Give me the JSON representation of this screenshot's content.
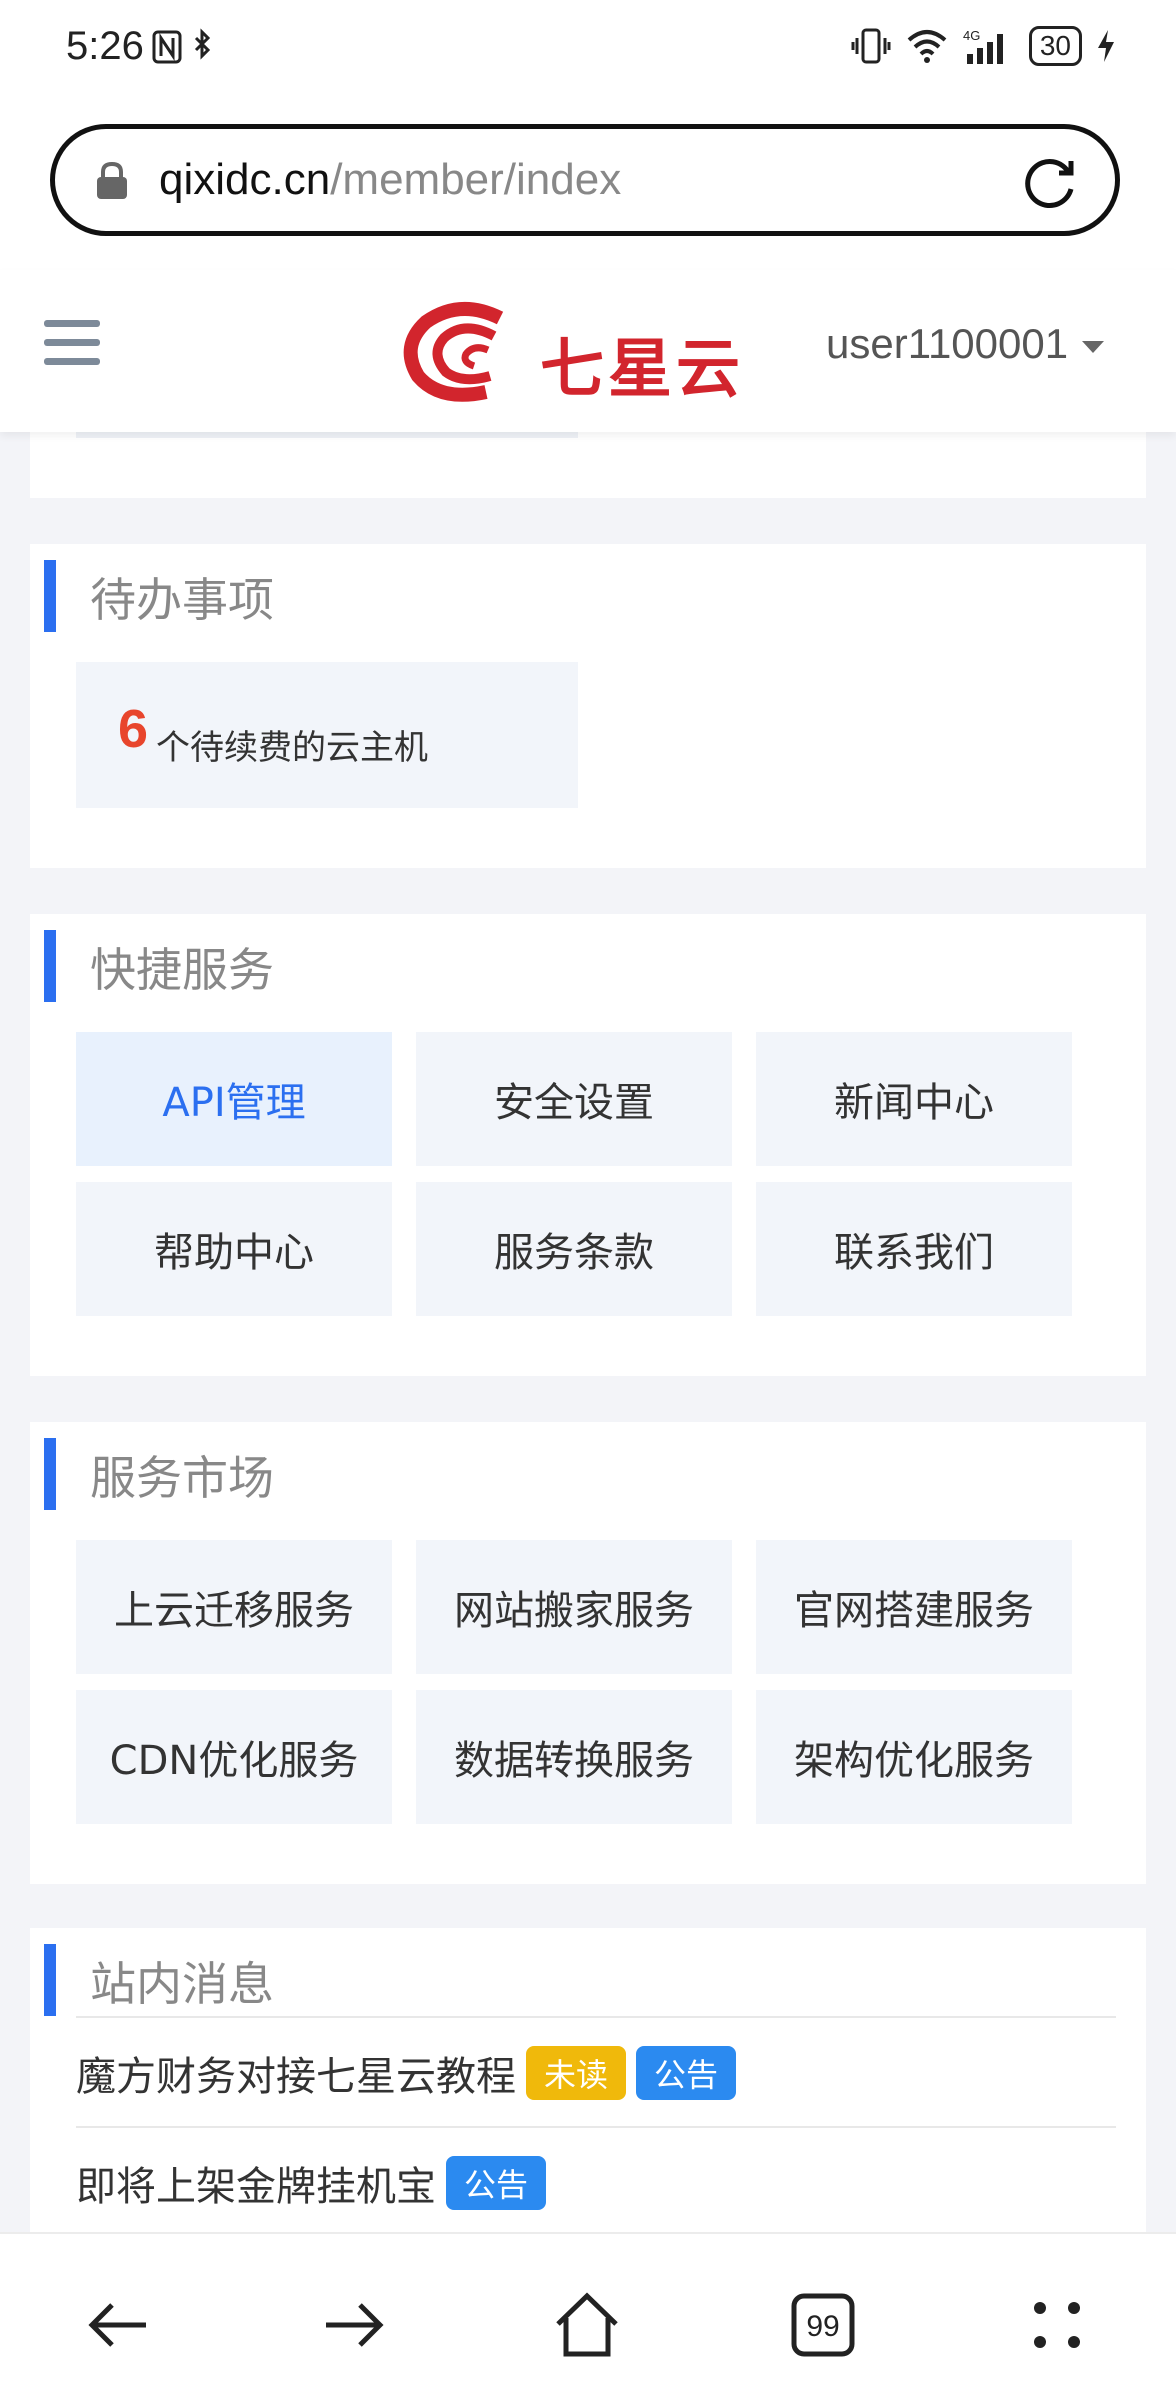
{
  "status_bar": {
    "time": "5:26",
    "battery": "30",
    "network": "4G"
  },
  "browser": {
    "url_domain": "qixidc.cn",
    "url_path": "/member/index"
  },
  "header": {
    "logo_text": "七星云",
    "username": "user1100001"
  },
  "todo": {
    "title": "待办事项",
    "items": [
      {
        "count": "6",
        "label": "个待续费的云主机"
      }
    ]
  },
  "quick_services": {
    "title": "快捷服务",
    "items": [
      {
        "label": "API管理"
      },
      {
        "label": "安全设置"
      },
      {
        "label": "新闻中心"
      },
      {
        "label": "帮助中心"
      },
      {
        "label": "服务条款"
      },
      {
        "label": "联系我们"
      }
    ]
  },
  "market": {
    "title": "服务市场",
    "items": [
      {
        "label": "上云迁移服务"
      },
      {
        "label": "网站搬家服务"
      },
      {
        "label": "官网搭建服务"
      },
      {
        "label": "CDN优化服务"
      },
      {
        "label": "数据转换服务"
      },
      {
        "label": "架构优化服务"
      }
    ]
  },
  "messages": {
    "title": "站内消息",
    "items": [
      {
        "text": "魔方财务对接七星云教程",
        "unread_tag": "未读",
        "type_tag": "公告"
      },
      {
        "text": "即将上架金牌挂机宝",
        "type_tag": "公告"
      }
    ]
  },
  "colors": {
    "accent": "#2b6ff0",
    "count": "#e8452c",
    "unread": "#f0b90b",
    "notice": "#2b8af0",
    "logo": "#d2252d"
  },
  "icons": [
    "lock-icon",
    "reload-icon",
    "menu-icon",
    "back-icon",
    "forward-icon",
    "home-icon",
    "tabs-icon",
    "more-icon"
  ],
  "tabs_count": "99"
}
